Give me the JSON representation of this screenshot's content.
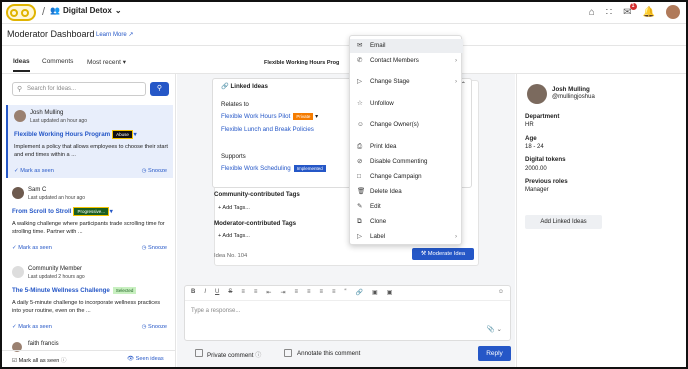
{
  "topbar": {
    "workspace": "Digital Detox",
    "notif_count": "1"
  },
  "header": {
    "title": "Moderator Dashboard",
    "learn_more": "Learn More"
  },
  "tabs": [
    {
      "label": "Ideas"
    },
    {
      "label": "Comments"
    },
    {
      "label": "Most recent"
    }
  ],
  "mid_title": "Flexible Working Hours Prog",
  "search": {
    "placeholder": "Search for Ideas..."
  },
  "cards": [
    {
      "author": "Josh Mulling",
      "updated": "Last updated an hour ago",
      "title": "Flexible Working Hours Program",
      "tag": "Abuse",
      "body": "Implement a policy that allows employees to choose their start and end times within a ...",
      "mark": "Mark as seen",
      "snooze": "Snooze"
    },
    {
      "author": "Sam C",
      "updated": "Last updated an hour ago",
      "title": "From Scroll to Stroll",
      "tag": "Progressive...",
      "body": "A walking challenge where participants trade scrolling time for strolling time. Partner with ...",
      "mark": "Mark as seen",
      "snooze": "Snooze"
    },
    {
      "author": "Community Member",
      "updated": "Last updated 2 hours ago",
      "title": "The 5-Minute Wellness Challenge",
      "tag": "Selected",
      "body": "A daily 5-minute challenge to incorporate wellness practices into your routine, even on the ...",
      "mark": "Mark as seen",
      "snooze": "Snooze"
    },
    {
      "author": "faith francis"
    }
  ],
  "left_footer": {
    "mark_all": "Mark all as seen",
    "seen": "Seen ideas"
  },
  "linked": {
    "title": "Linked Ideas",
    "relates_to": "Relates to",
    "rel1": "Flexible Work Hours Pilot",
    "rel1_tag": "Private",
    "rel2": "Flexible Lunch and Break Policies",
    "supports": "Supports",
    "sup1": "Flexible Work Scheduling",
    "sup1_tag": "Implemented"
  },
  "tags": {
    "community": "Community-contributed Tags",
    "moderator": "Moderator-contributed Tags",
    "add": "+ Add Tags..."
  },
  "idea_no": "Idea No. 104",
  "moderate_btn": "Moderate Idea",
  "editor": {
    "placeholder": "Type a response...",
    "private": "Private comment",
    "annotate": "Annotate this comment",
    "reply": "Reply"
  },
  "menu": [
    {
      "label": "Email",
      "icon": "mail-icon"
    },
    {
      "label": "Contact Members",
      "icon": "phone-icon",
      "sub": true
    },
    {
      "label": "Change Stage",
      "icon": "stage-icon",
      "sub": true
    },
    {
      "label": "Unfollow",
      "icon": "star-icon"
    },
    {
      "label": "Change Owner(s)",
      "icon": "owner-icon"
    },
    {
      "label": "Print Idea",
      "icon": "print-icon"
    },
    {
      "label": "Disable Commenting",
      "icon": "comment-off-icon"
    },
    {
      "label": "Change Campaign",
      "icon": "campaign-icon"
    },
    {
      "label": "Delete Idea",
      "icon": "trash-icon"
    },
    {
      "label": "Edit",
      "icon": "edit-icon"
    },
    {
      "label": "Clone",
      "icon": "clone-icon"
    },
    {
      "label": "Label",
      "icon": "label-icon",
      "sub": true
    }
  ],
  "profile": {
    "name": "Josh Mulling",
    "handle": "@mullingjoshua",
    "fields": [
      {
        "k": "Department",
        "v": "HR"
      },
      {
        "k": "Age",
        "v": "18 - 24"
      },
      {
        "k": "Digital tokens",
        "v": "2000.00"
      },
      {
        "k": "Previous roles",
        "v": "Manager"
      }
    ],
    "add_linked": "Add Linked Ideas"
  }
}
